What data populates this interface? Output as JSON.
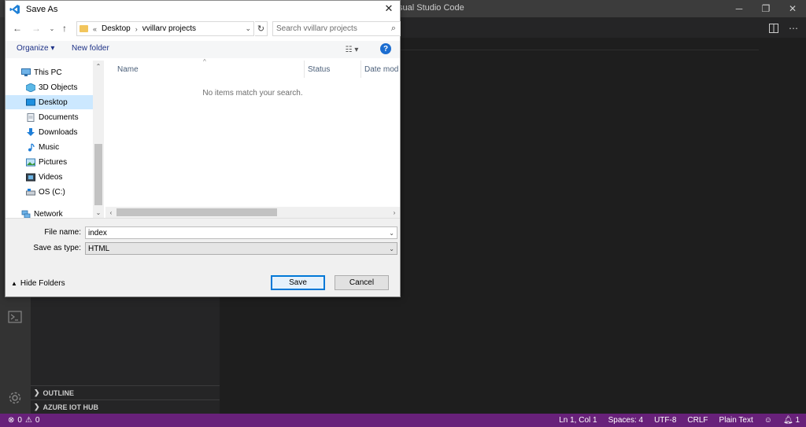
{
  "vscode": {
    "window_title": "sual Studio Code",
    "statusbar": {
      "errors": "0",
      "warnings": "0",
      "position": "Ln 1, Col 1",
      "spaces": "Spaces: 4",
      "encoding": "UTF-8",
      "eol": "CRLF",
      "language": "Plain Text",
      "notifications": "1"
    },
    "sidebar_sections": [
      "OUTLINE",
      "AZURE IOT HUB"
    ]
  },
  "dialog": {
    "title": "Save As",
    "breadcrumb": [
      "Desktop",
      "vvillarv projects"
    ],
    "breadcrumb_prefix": "«",
    "search_placeholder": "Search vvillarv projects",
    "organize_label": "Organize ▾",
    "new_folder_label": "New folder",
    "nav_tree": [
      {
        "label": "This PC",
        "icon": "computer-icon"
      },
      {
        "label": "3D Objects",
        "icon": "cube-icon"
      },
      {
        "label": "Desktop",
        "icon": "desktop-icon",
        "selected": true
      },
      {
        "label": "Documents",
        "icon": "document-icon"
      },
      {
        "label": "Downloads",
        "icon": "download-icon"
      },
      {
        "label": "Music",
        "icon": "music-icon"
      },
      {
        "label": "Pictures",
        "icon": "pictures-icon"
      },
      {
        "label": "Videos",
        "icon": "video-icon"
      },
      {
        "label": "OS (C:)",
        "icon": "drive-icon"
      },
      {
        "label": "Network",
        "icon": "network-icon"
      }
    ],
    "columns": [
      "Name",
      "Status",
      "Date modifi"
    ],
    "empty_message": "No items match your search.",
    "file_name_label": "File name:",
    "file_name_value": "index",
    "save_type_label": "Save as type:",
    "save_type_value": "HTML",
    "hide_folders_label": "Hide Folders",
    "save_label": "Save",
    "cancel_label": "Cancel"
  },
  "colors": {
    "statusbar": "#68217a",
    "selection": "#cce8ff",
    "primary_button_border": "#0078d7"
  }
}
